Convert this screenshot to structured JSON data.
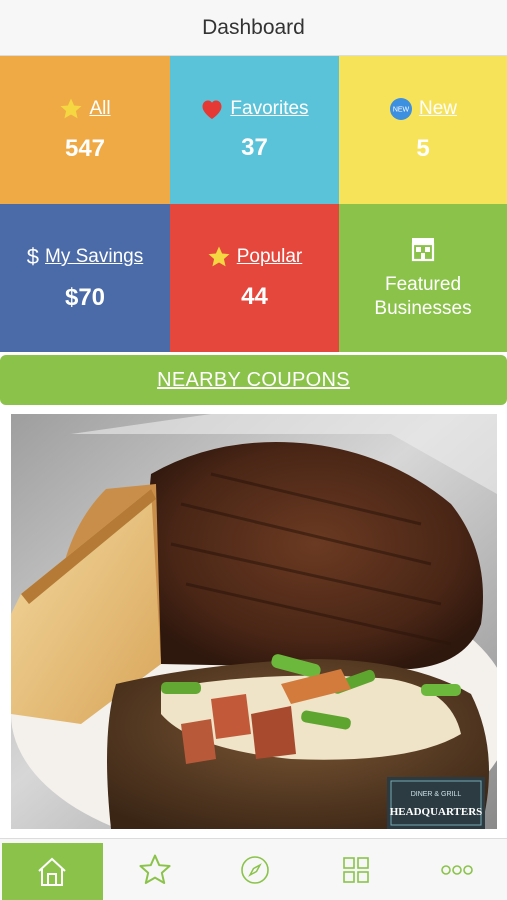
{
  "header": {
    "title": "Dashboard"
  },
  "tiles": {
    "all": {
      "label": "All",
      "count": "547",
      "icon": "star-icon"
    },
    "favorites": {
      "label": "Favorites",
      "count": "37",
      "icon": "heart-icon"
    },
    "new": {
      "label": "New",
      "count": "5",
      "icon": "new-badge-icon",
      "badge_text": "NEW"
    },
    "savings": {
      "symbol": "$",
      "label": "My Savings",
      "count": "$70"
    },
    "popular": {
      "label": "Popular",
      "count": "44",
      "icon": "star-icon"
    },
    "featured": {
      "label_line1": "Featured",
      "label_line2": "Businesses",
      "icon": "storefront-icon"
    }
  },
  "nearby": {
    "label": "NEARBY COUPONS"
  },
  "photo": {
    "logo_line1": "DINER & GRILL",
    "logo_line2": "HEADQUARTERS"
  },
  "tabbar": {
    "items": [
      {
        "name": "home",
        "icon": "home-icon",
        "active": true
      },
      {
        "name": "favorites",
        "icon": "star-outline-icon",
        "active": false
      },
      {
        "name": "explore",
        "icon": "compass-icon",
        "active": false
      },
      {
        "name": "categories",
        "icon": "grid-icon",
        "active": false
      },
      {
        "name": "more",
        "icon": "more-dots-icon",
        "active": false
      }
    ]
  },
  "colors": {
    "all_tile": "#efaa45",
    "favorites_tile": "#5bc3d9",
    "new_tile": "#f7e35a",
    "savings_tile": "#4a6aa8",
    "popular_tile": "#e5473c",
    "featured_tile": "#8bc34a",
    "accent_green": "#8bc34a"
  }
}
